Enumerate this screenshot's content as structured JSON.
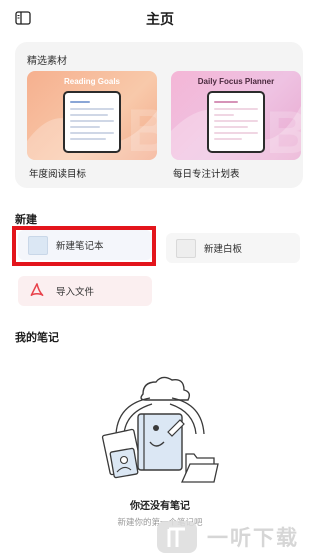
{
  "header": {
    "title": "主页",
    "menu_icon": "sidebar-toggle-icon"
  },
  "featured": {
    "label": "精选素材",
    "templates": [
      {
        "preview_title": "Reading Goals",
        "name": "年度阅读目标"
      },
      {
        "preview_title": "Daily Focus Planner",
        "name": "每日专注计划表"
      }
    ]
  },
  "new_section": {
    "label": "新建",
    "actions": [
      {
        "label": "新建笔记本",
        "icon": "notebook-icon"
      },
      {
        "label": "新建白板",
        "icon": "whiteboard-icon"
      },
      {
        "label": "导入文件",
        "icon": "pdf-import-icon"
      }
    ]
  },
  "notes_section": {
    "label": "我的笔记",
    "empty_title": "你还没有笔记",
    "empty_subtitle": "新建你的第一个笔记吧"
  },
  "watermark": {
    "text": "一听下载"
  },
  "colors": {
    "highlight": "#e3151c",
    "accent_red": "#e8424b"
  }
}
